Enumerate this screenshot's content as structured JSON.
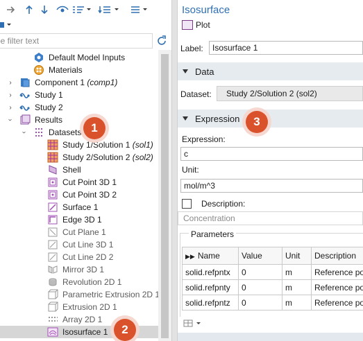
{
  "left": {
    "filter_placeholder": "pe filter text",
    "tree": [
      {
        "label": "Default Model Inputs",
        "icon": "model-inputs-icon"
      },
      {
        "label": "Materials",
        "icon": "materials-icon"
      },
      {
        "label": "Component 1 ",
        "label_em": "(comp1)",
        "icon": "component-icon"
      },
      {
        "label": "Study 1",
        "icon": "study-icon"
      },
      {
        "label": "Study 2",
        "icon": "study-icon"
      },
      {
        "label": "Results",
        "icon": "results-icon"
      },
      {
        "label": "Datasets",
        "icon": "datasets-icon"
      },
      {
        "label": "Study 1/Solution 1 ",
        "label_em": "(sol1)",
        "icon": "solution-icon"
      },
      {
        "label": "Study 2/Solution 2 ",
        "label_em": "(sol2)",
        "icon": "solution-icon"
      },
      {
        "label": "Shell",
        "icon": "shell-icon"
      },
      {
        "label": "Cut Point 3D 1",
        "icon": "cut-point-icon"
      },
      {
        "label": "Cut Point 3D 2",
        "icon": "cut-point-icon"
      },
      {
        "label": "Surface 1",
        "icon": "surface-icon"
      },
      {
        "label": "Edge 3D 1",
        "icon": "edge-icon"
      },
      {
        "label": "Cut Plane 1",
        "icon": "cut-plane-icon"
      },
      {
        "label": "Cut Line 3D 1",
        "icon": "cut-line-icon"
      },
      {
        "label": "Cut Line 2D 2",
        "icon": "cut-line-icon"
      },
      {
        "label": "Mirror 3D 1",
        "icon": "mirror-icon"
      },
      {
        "label": "Revolution 2D 1",
        "icon": "revolution-icon"
      },
      {
        "label": "Parametric Extrusion 2D 1",
        "icon": "parametric-extrusion-icon"
      },
      {
        "label": "Extrusion 2D 1",
        "icon": "extrusion-icon"
      },
      {
        "label": "Array 2D 1",
        "icon": "array-icon"
      },
      {
        "label": "Isosurface 1",
        "icon": "isosurface-icon"
      }
    ]
  },
  "right": {
    "title": "Isosurface",
    "plot_label": "Plot",
    "label_field_label": "Label:",
    "label_value": "Isosurface 1",
    "data_section": "Data",
    "dataset_label": "Dataset:",
    "dataset_value": "Study 2/Solution 2 (sol2)",
    "expression_section": "Expression",
    "expression_label": "Expression:",
    "expression_value": "c",
    "unit_label": "Unit:",
    "unit_value": "mol/m^3",
    "description_label": "Description:",
    "description_value": "Concentration",
    "parameters_title": "Parameters",
    "table": {
      "headers": [
        "Name",
        "Value",
        "Unit",
        "Description"
      ],
      "rows": [
        [
          "solid.refpntx",
          "0",
          "m",
          "Reference poin"
        ],
        [
          "solid.refpnty",
          "0",
          "m",
          "Reference poin"
        ],
        [
          "solid.refpntz",
          "0",
          "m",
          "Reference poin"
        ]
      ]
    }
  },
  "callouts": [
    "1",
    "2",
    "3"
  ],
  "colors": {
    "accent_blue": "#2e6fb3",
    "section_bg": "#e6ebf0",
    "badge": "#d9522c",
    "selection": "#d6d6d6"
  }
}
